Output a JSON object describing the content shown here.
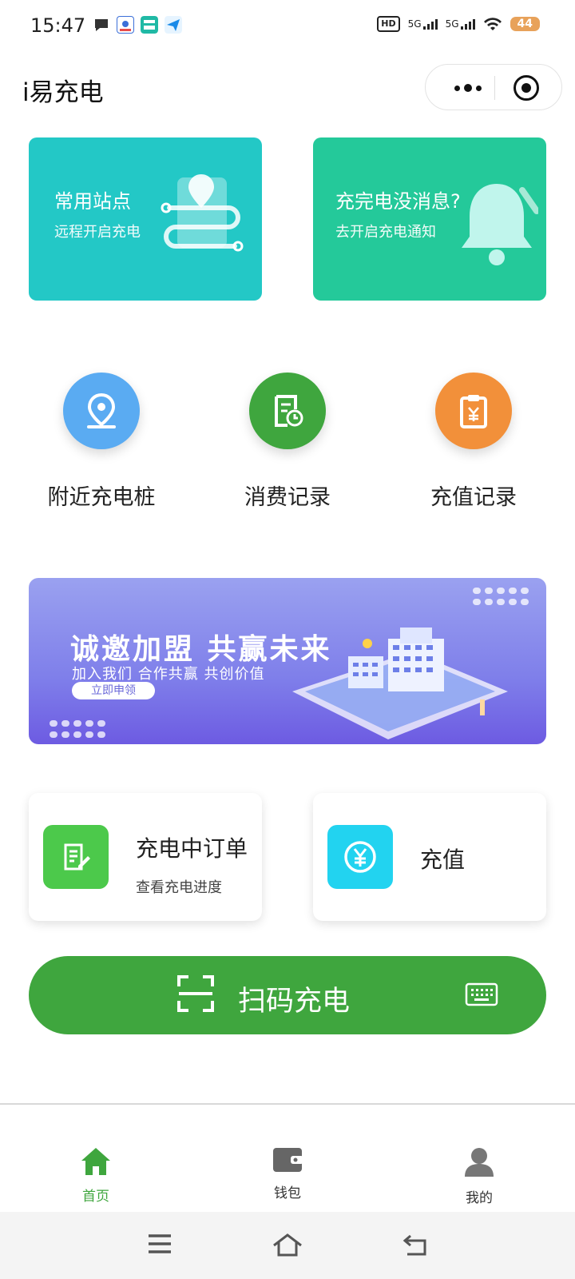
{
  "status_bar": {
    "time": "15:47",
    "network_1": "5G",
    "network_2": "5G",
    "battery": "44"
  },
  "header": {
    "title": "i易充电"
  },
  "feature_cards": [
    {
      "title": "常用站点",
      "subtitle": "远程开启充电",
      "color": "#23c8c6",
      "icon": "map-route-icon"
    },
    {
      "title": "充完电没消息?",
      "subtitle": "去开启充电通知",
      "color": "#24c99a",
      "icon": "bell-icon"
    }
  ],
  "quick_actions": [
    {
      "label": "附近充电桩",
      "color": "#5aabf2",
      "icon": "location-pin-icon"
    },
    {
      "label": "消费记录",
      "color": "#3fa63e",
      "icon": "receipt-clock-icon"
    },
    {
      "label": "充值记录",
      "color": "#f2903a",
      "icon": "clipboard-yen-icon"
    }
  ],
  "banner": {
    "title": "诚邀加盟  共赢未来",
    "subtitle": "加入我们  合作共赢  共创价值",
    "button": "立即申领"
  },
  "order_cards": [
    {
      "title": "充电中订单",
      "subtitle": "查看充电进度",
      "color": "#4cc94b",
      "icon": "edit-note-icon"
    },
    {
      "title": "充值",
      "color": "#22d3f0",
      "icon": "yen-coin-icon"
    }
  ],
  "scan_button": {
    "label": "扫码充电",
    "color": "#3fa63e"
  },
  "tabbar": [
    {
      "label": "首页",
      "icon": "home-icon",
      "active": true
    },
    {
      "label": "钱包",
      "icon": "wallet-icon",
      "active": false
    },
    {
      "label": "我的",
      "icon": "user-icon",
      "active": false
    }
  ]
}
